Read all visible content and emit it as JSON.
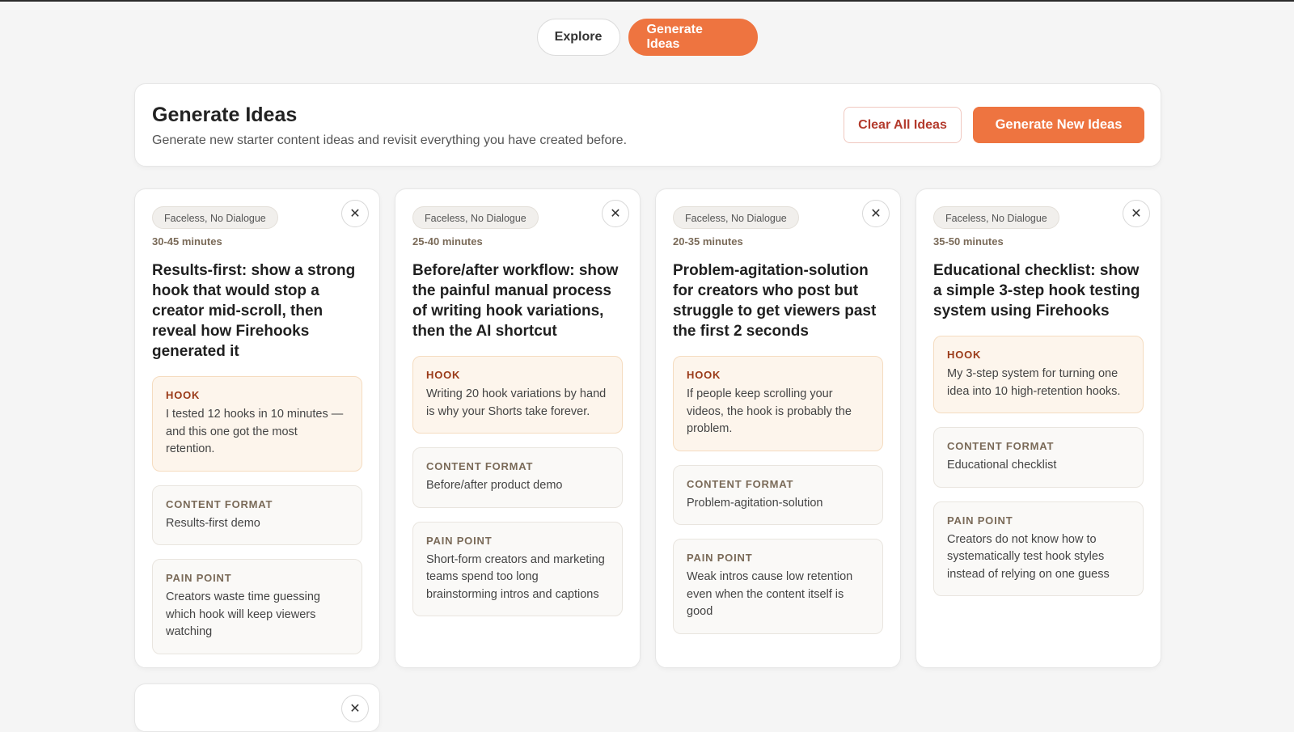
{
  "nav": {
    "explore": "Explore",
    "generate": "Generate Ideas"
  },
  "header": {
    "title": "Generate Ideas",
    "subtitle": "Generate new starter content ideas and revisit everything you have created before.",
    "clear_label": "Clear All Ideas",
    "new_label": "Generate New Ideas"
  },
  "close_glyph": "✕",
  "cards": [
    {
      "tag": "Faceless, No Dialogue",
      "duration": "30-45 minutes",
      "title": "Results-first: show a strong hook that would stop a creator mid-scroll, then reveal how Firehooks generated it",
      "hook_label": "HOOK",
      "hook": "I tested 12 hooks in 10 minutes — and this one got the most retention.",
      "format_label": "CONTENT FORMAT",
      "format": "Results-first demo",
      "pain_label": "PAIN POINT",
      "pain": "Creators waste time guessing which hook will keep viewers watching"
    },
    {
      "tag": "Faceless, No Dialogue",
      "duration": "25-40 minutes",
      "title": "Before/after workflow: show the painful manual process of writing hook variations, then the AI shortcut",
      "hook_label": "HOOK",
      "hook": "Writing 20 hook variations by hand is why your Shorts take forever.",
      "format_label": "CONTENT FORMAT",
      "format": "Before/after product demo",
      "pain_label": "PAIN POINT",
      "pain": "Short-form creators and marketing teams spend too long brainstorming intros and captions"
    },
    {
      "tag": "Faceless, No Dialogue",
      "duration": "20-35 minutes",
      "title": "Problem-agitation-solution for creators who post but struggle to get viewers past the first 2 seconds",
      "hook_label": "HOOK",
      "hook": "If people keep scrolling your videos, the hook is probably the problem.",
      "format_label": "CONTENT FORMAT",
      "format": "Problem-agitation-solution",
      "pain_label": "PAIN POINT",
      "pain": "Weak intros cause low retention even when the content itself is good"
    },
    {
      "tag": "Faceless, No Dialogue",
      "duration": "35-50 minutes",
      "title": "Educational checklist: show a simple 3-step hook testing system using Firehooks",
      "hook_label": "HOOK",
      "hook": "My 3-step system for turning one idea into 10 high-retention hooks.",
      "format_label": "CONTENT FORMAT",
      "format": "Educational checklist",
      "pain_label": "PAIN POINT",
      "pain": "Creators do not know how to systematically test hook styles instead of relying on one guess"
    }
  ]
}
